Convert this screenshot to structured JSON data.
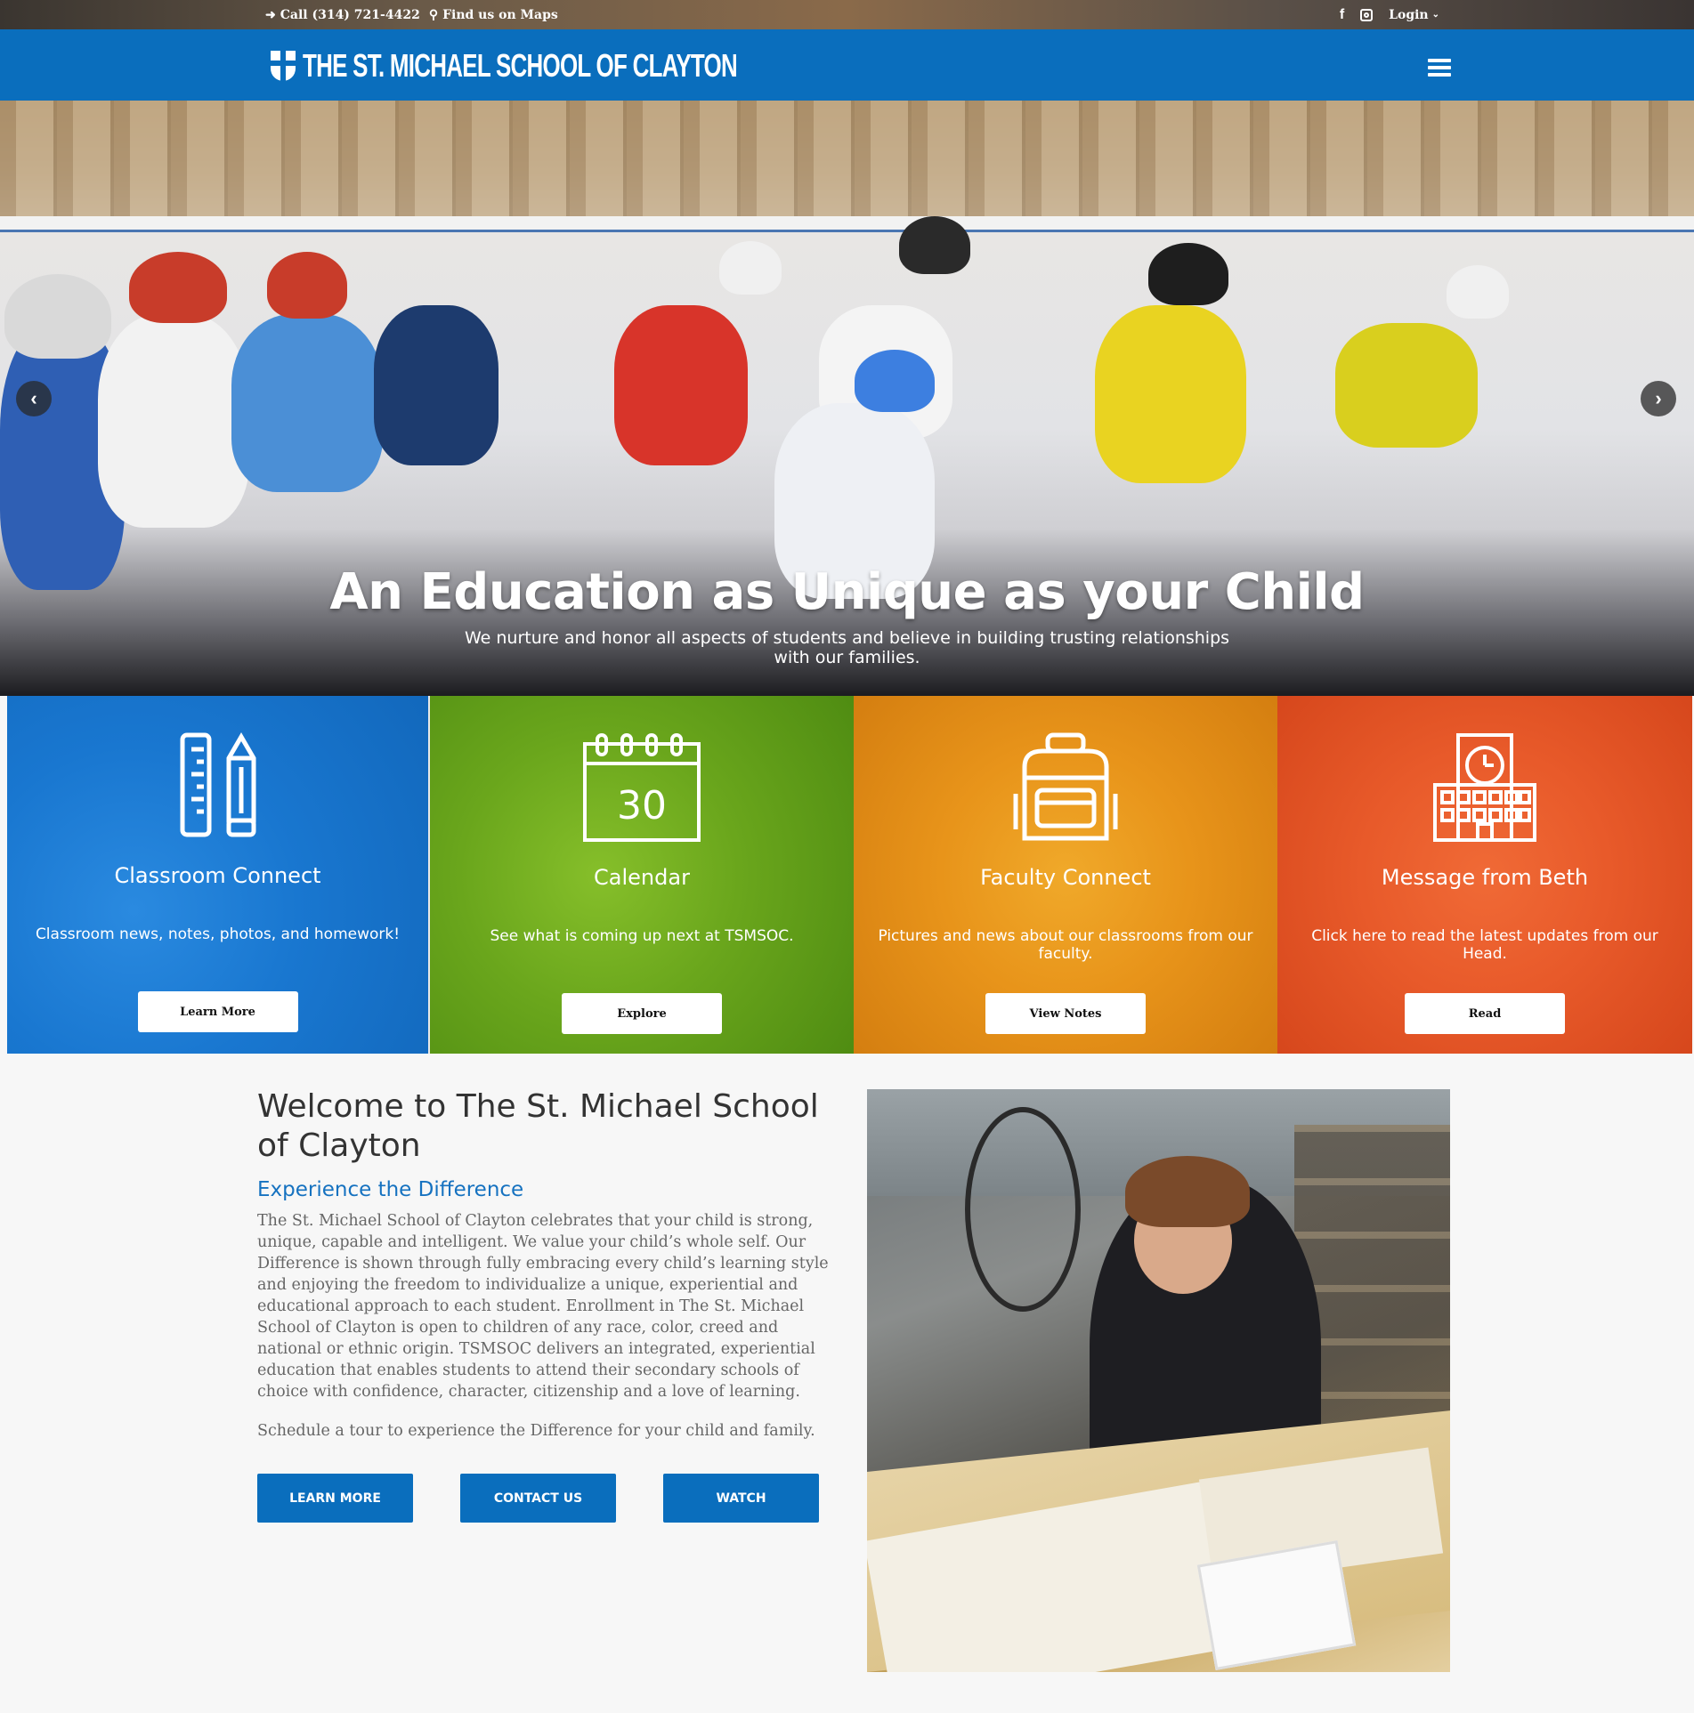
{
  "topbar": {
    "phone_label": "Call (314) 721-4422",
    "maps_label": "Find us on Maps",
    "facebook_icon": "facebook-icon",
    "instagram_icon": "instagram-icon",
    "login_label": "Login"
  },
  "nav": {
    "logo_text": "THE ST. MICHAEL SCHOOL OF CLAYTON",
    "menu_icon": "hamburger-menu-icon"
  },
  "hero": {
    "title": "An Education as Unique as your Child",
    "subtitle": "We nurture and honor all aspects of students and believe in building trusting relationships with our families.",
    "prev_icon": "chevron-left-icon",
    "next_icon": "chevron-right-icon"
  },
  "tiles": [
    {
      "title": "Classroom Connect",
      "text": "Classroom news, notes, photos, and homework!",
      "button": "Learn More",
      "color": "#1a7fd8",
      "icon": "ruler-pencil-icon"
    },
    {
      "title": "Calendar",
      "text": "See what is coming up next at TSMSOC.",
      "button": "Explore",
      "color": "#6aaa1a",
      "icon": "calendar-icon",
      "icon_text": "30"
    },
    {
      "title": "Faculty Connect",
      "text": "Pictures and news about our classrooms from our faculty.",
      "button": "View Notes",
      "color": "#e8951a",
      "icon": "backpack-icon"
    },
    {
      "title": "Message from Beth",
      "text": "Click here to read the latest updates from our Head.",
      "button": "Read",
      "color": "#ea5a2a",
      "icon": "school-building-icon"
    }
  ],
  "welcome": {
    "heading": "Welcome to The St. Michael School of Clayton",
    "subheading": "Experience the Difference",
    "body": "The St. Michael School of Clayton celebrates that your child is strong, unique, capable and intelligent. We value your child’s whole self. Our Difference is shown through fully embracing every child’s learning style and enjoying the freedom to individualize a unique, experiential and educational approach to each student. Enrollment in The St. Michael School of Clayton is open to children of any race, color, creed and national or ethnic origin. TSMSOC delivers an integrated, experiential education that enables students to attend their secondary schools of choice with confidence, character, citizenship and a love of learning.",
    "tour": "Schedule a tour to experience the Difference for your child and family.",
    "buttons": [
      "LEARN MORE",
      "CONTACT US",
      "WATCH"
    ]
  }
}
